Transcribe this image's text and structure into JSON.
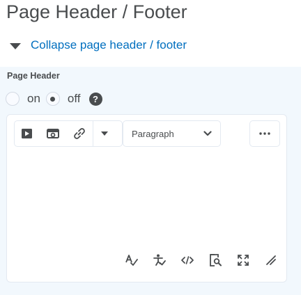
{
  "page": {
    "title": "Page Header / Footer"
  },
  "collapse": {
    "label": "Collapse page header / footer"
  },
  "section": {
    "label": "Page Header"
  },
  "radio": {
    "on_label": "on",
    "off_label": "off",
    "selected": "off"
  },
  "help": {
    "glyph": "?"
  },
  "toolbar": {
    "items": [
      "video-icon",
      "image-icon",
      "link-icon",
      "dropdown-caret-icon"
    ],
    "format_value": "Paragraph",
    "more_glyph": "•••"
  },
  "bottom_toolbar": {
    "items": [
      "spellcheck-icon",
      "accessibility-check-icon",
      "source-code-icon",
      "preview-icon",
      "fullscreen-icon",
      "resize-icon"
    ]
  },
  "colors": {
    "link": "#006fbf",
    "text": "#494c4e",
    "panel_bg": "#f2f8fd",
    "border": "#e3e9f1"
  }
}
